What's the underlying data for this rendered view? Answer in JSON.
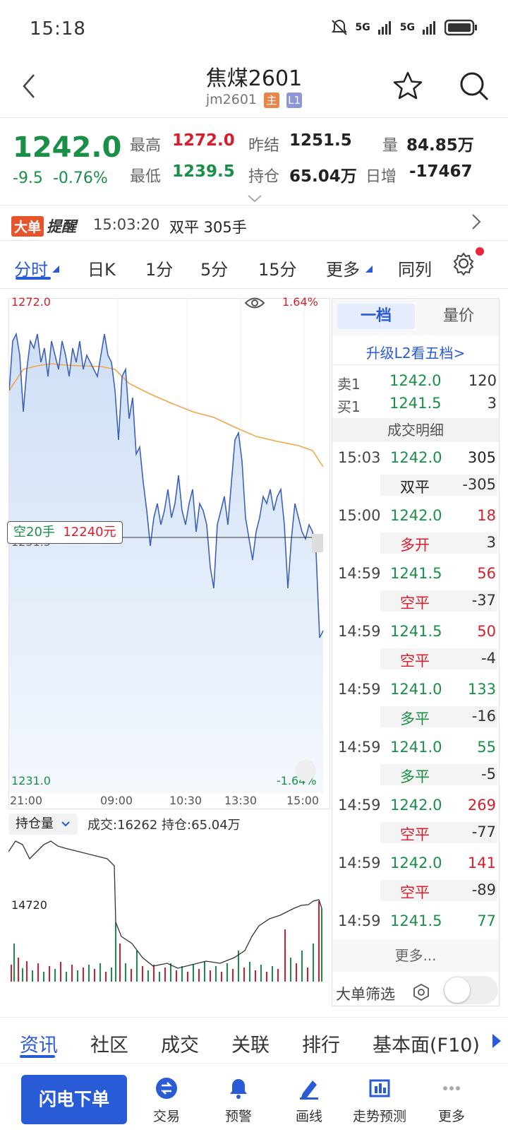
{
  "status": {
    "time": "15:18",
    "signal1": "5G",
    "signal2": "5G"
  },
  "header": {
    "title": "焦煤2601",
    "code": "jm2601",
    "tag_main": "主",
    "tag_l1": "L1"
  },
  "quote": {
    "price": "1242.0",
    "change": "-9.5",
    "change_pct": "-0.76%",
    "high_label": "最高",
    "high": "1272.0",
    "low_label": "最低",
    "low": "1239.5",
    "prev_settle_label": "昨结",
    "prev_settle": "1251.5",
    "oi_label": "持仓",
    "oi": "65.04万",
    "vol_label": "量",
    "vol": "84.85万",
    "daily_inc_label": "日增",
    "daily_inc": "-17467"
  },
  "alert": {
    "badge": "大单",
    "title": "提醒",
    "time": "15:03:20",
    "text": "双平  305手"
  },
  "tabs": [
    "分时",
    "日K",
    "1分",
    "5分",
    "15分",
    "更多",
    "同列"
  ],
  "chart": {
    "y_top": "1272.0",
    "y_mid": "1251.5",
    "y_bottom": "1231.0",
    "pct_top": "1.64%",
    "pct_bottom": "-1.64%",
    "x_labels": [
      "21:00",
      "09:00",
      "10:30",
      "13:30",
      "15:00"
    ],
    "position_tag": "空20手",
    "position_amt": "12240元",
    "sub_selector": "持仓量",
    "sub_info": "成交:16262 持仓:65.04万",
    "sub_level": "14720"
  },
  "chart_data": {
    "type": "line",
    "ylim": [
      1231.0,
      1272.0
    ],
    "x": [
      "21:00",
      "09:00",
      "10:30",
      "13:30",
      "15:00"
    ],
    "series": [],
    "prev_settle": 1251.5
  },
  "orderbook": {
    "tab1": "一档",
    "tab2": "量价",
    "upgrade": "升级L2看五档>",
    "ask_label": "卖1",
    "ask_price": "1242.0",
    "ask_vol": "120",
    "bid_label": "买1",
    "bid_price": "1241.5",
    "bid_vol": "3",
    "detail_title": "成交明细",
    "trades": [
      {
        "time": "15:03",
        "price": "1242.0",
        "vol": "305",
        "type": "双平",
        "chg": "-305"
      },
      {
        "time": "15:00",
        "price": "1242.0",
        "vol": "18",
        "type": "多开",
        "chg": "3"
      },
      {
        "time": "14:59",
        "price": "1241.5",
        "vol": "56",
        "type": "空平",
        "chg": "-37"
      },
      {
        "time": "14:59",
        "price": "1241.5",
        "vol": "50",
        "type": "空平",
        "chg": "-4"
      },
      {
        "time": "14:59",
        "price": "1241.0",
        "vol": "133",
        "type": "多平",
        "chg": "-16"
      },
      {
        "time": "14:59",
        "price": "1241.0",
        "vol": "55",
        "type": "多平",
        "chg": "-5"
      },
      {
        "time": "14:59",
        "price": "1242.0",
        "vol": "269",
        "type": "空平",
        "chg": "-77"
      },
      {
        "time": "14:59",
        "price": "1242.0",
        "vol": "141",
        "type": "空平",
        "chg": "-89"
      },
      {
        "time": "14:59",
        "price": "1241.5",
        "vol": "77",
        "type": "",
        "chg": ""
      }
    ],
    "more": "更多...",
    "filter": "大单筛选"
  },
  "nav_tabs": [
    "资讯",
    "社区",
    "成交",
    "关联",
    "排行",
    "基本面(F10)"
  ],
  "bottom": {
    "flash_order": "闪电下单",
    "items": [
      "交易",
      "预警",
      "画线",
      "走势预测",
      "更多"
    ]
  }
}
